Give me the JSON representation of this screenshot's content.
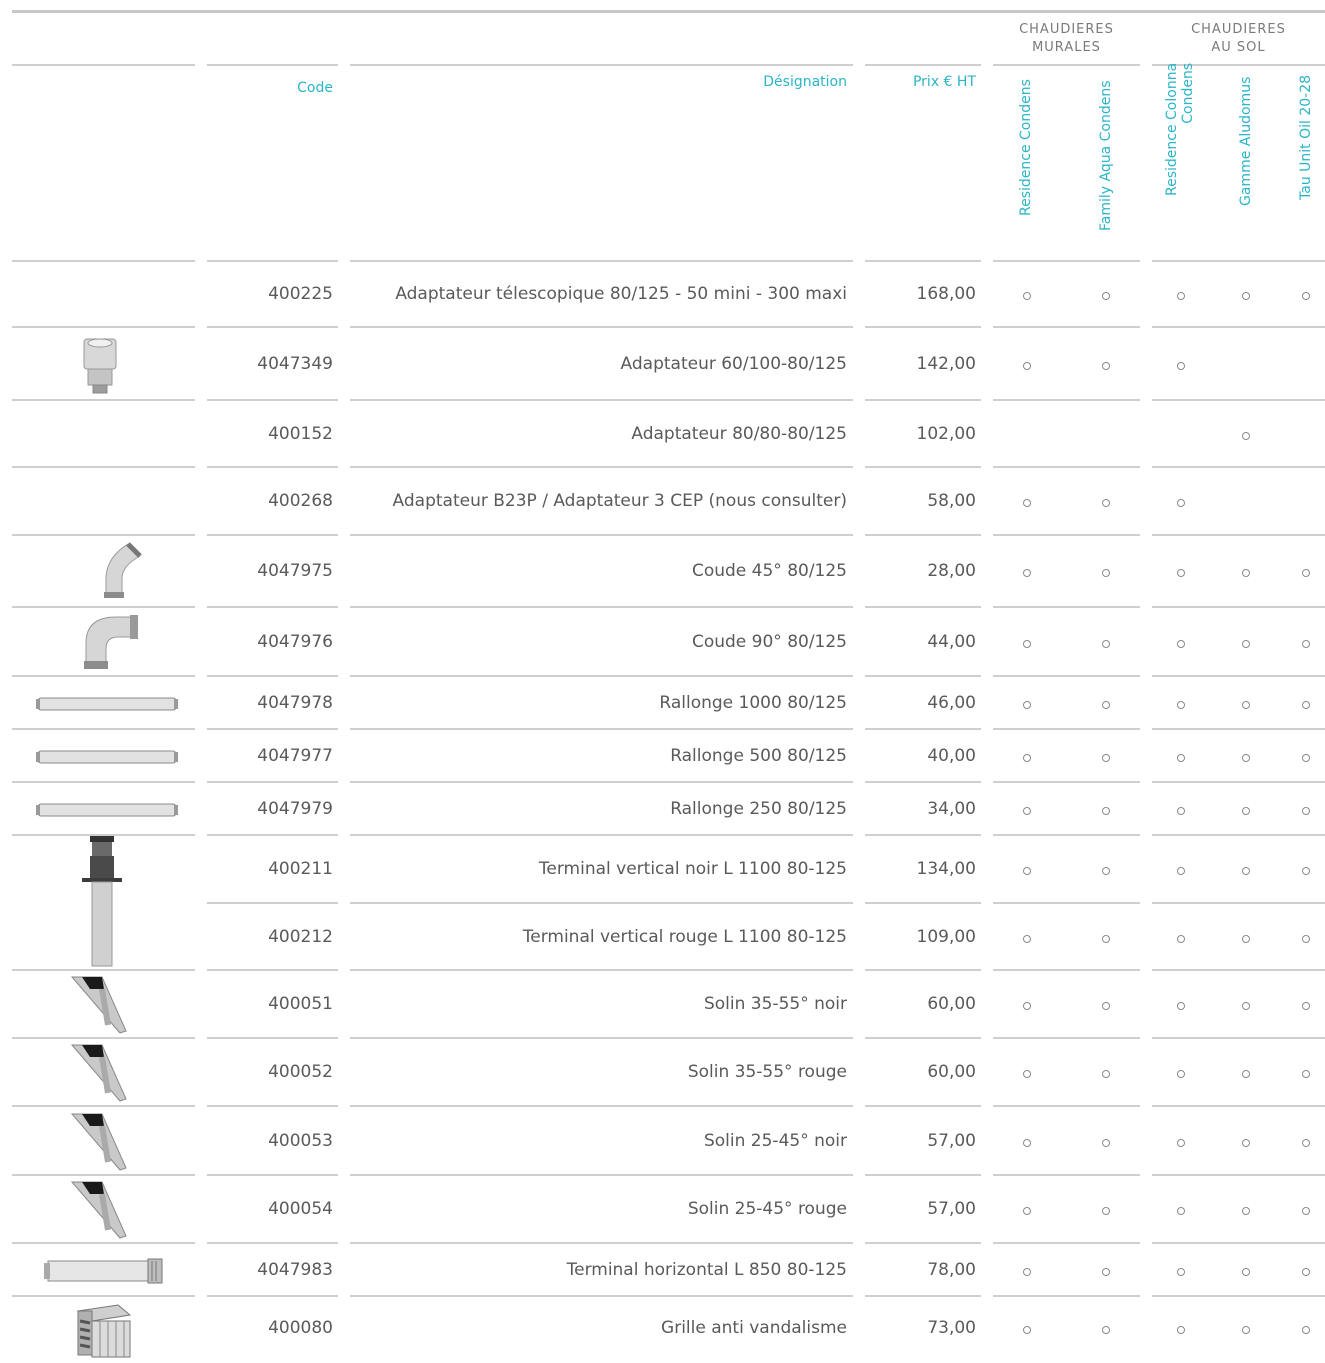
{
  "header": {
    "group_murales": [
      "CHAUDIERES",
      "MURALES"
    ],
    "group_sol": [
      "CHAUDIERES",
      "AU SOL"
    ],
    "col_code": "Code",
    "col_designation": "Désignation",
    "col_price": "Prix € HT",
    "boilers": [
      "Residence Condens",
      "Family Aqua Condens",
      "Residence Colonna\nCondens",
      "Gamme Aludomus",
      "Tau Unit Oil 20-28"
    ]
  },
  "products": [
    {
      "code": "400225",
      "designation": "Adaptateur télescopique 80/125 - 50 mini - 300 maxi",
      "price": "168,00",
      "compat": [
        true,
        true,
        true,
        true,
        true
      ],
      "image": ""
    },
    {
      "code": "4047349",
      "designation": "Adaptateur 60/100-80/125",
      "price": "142,00",
      "compat": [
        true,
        true,
        true,
        false,
        false
      ],
      "image": "adapter-image"
    },
    {
      "code": "400152",
      "designation": "Adaptateur 80/80-80/125",
      "price": "102,00",
      "compat": [
        false,
        false,
        false,
        true,
        false
      ],
      "image": ""
    },
    {
      "code": "400268",
      "designation": "Adaptateur B23P / Adaptateur 3 CEP (nous consulter)",
      "price": "58,00",
      "compat": [
        true,
        true,
        true,
        false,
        false
      ],
      "image": ""
    },
    {
      "code": "4047975",
      "designation": "Coude 45° 80/125",
      "price": "28,00",
      "compat": [
        true,
        true,
        true,
        true,
        true
      ],
      "image": "elbow-45-image"
    },
    {
      "code": "4047976",
      "designation": "Coude 90° 80/125",
      "price": "44,00",
      "compat": [
        true,
        true,
        true,
        true,
        true
      ],
      "image": "elbow-90-image"
    },
    {
      "code": "4047978",
      "designation": "Rallonge 1000 80/125",
      "price": "46,00",
      "compat": [
        true,
        true,
        true,
        true,
        true
      ],
      "image": "extension-image"
    },
    {
      "code": "4047977",
      "designation": "Rallonge 500 80/125",
      "price": "40,00",
      "compat": [
        true,
        true,
        true,
        true,
        true
      ],
      "image": "extension-image"
    },
    {
      "code": "4047979",
      "designation": "Rallonge 250 80/125",
      "price": "34,00",
      "compat": [
        true,
        true,
        true,
        true,
        true
      ],
      "image": "extension-image"
    },
    {
      "code": "400211",
      "designation": "Terminal vertical noir L 1100 80-125",
      "price": "134,00",
      "compat": [
        true,
        true,
        true,
        true,
        true
      ],
      "image": "vertical-terminal-image"
    },
    {
      "code": "400212",
      "designation": "Terminal vertical rouge L 1100 80-125",
      "price": "109,00",
      "compat": [
        true,
        true,
        true,
        true,
        true
      ],
      "image": ""
    },
    {
      "code": "400051",
      "designation": "Solin 35-55° noir",
      "price": "60,00",
      "compat": [
        true,
        true,
        true,
        true,
        true
      ],
      "image": "flashing-image"
    },
    {
      "code": "400052",
      "designation": "Solin 35-55° rouge",
      "price": "60,00",
      "compat": [
        true,
        true,
        true,
        true,
        true
      ],
      "image": "flashing-image"
    },
    {
      "code": "400053",
      "designation": "Solin 25-45° noir",
      "price": "57,00",
      "compat": [
        true,
        true,
        true,
        true,
        true
      ],
      "image": "flashing-image"
    },
    {
      "code": "400054",
      "designation": "Solin 25-45° rouge",
      "price": "57,00",
      "compat": [
        true,
        true,
        true,
        true,
        true
      ],
      "image": "flashing-image"
    },
    {
      "code": "4047983",
      "designation": "Terminal horizontal L 850 80-125",
      "price": "78,00",
      "compat": [
        true,
        true,
        true,
        true,
        true
      ],
      "image": "horizontal-terminal-image"
    },
    {
      "code": "400080",
      "designation": "Grille anti vandalisme",
      "price": "73,00",
      "compat": [
        true,
        true,
        true,
        true,
        true
      ],
      "image": "grille-image"
    }
  ]
}
